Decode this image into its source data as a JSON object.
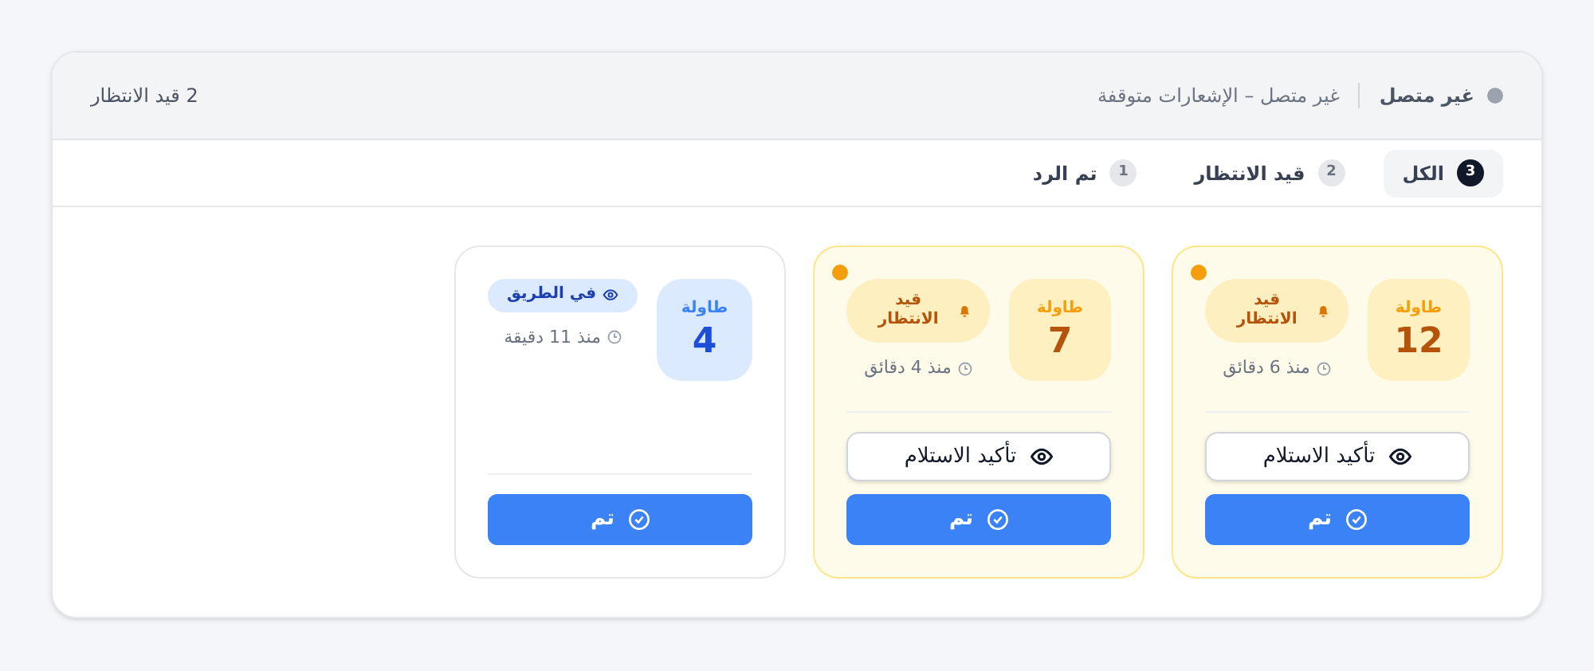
{
  "header": {
    "connection": {
      "label": "غير متصل",
      "color": "#9ca3af"
    },
    "message": "غير متصل – الإشعارات متوقفة",
    "pending_summary": "2 قيد الانتظار"
  },
  "tabs": [
    {
      "label": "الكل",
      "count": "3",
      "selected": true
    },
    {
      "label": "قيد الانتظار",
      "count": "2",
      "selected": false
    },
    {
      "label": "تم الرد",
      "count": "1",
      "selected": false
    }
  ],
  "cards": [
    {
      "kind": "pending",
      "unread": true,
      "table_label": "طاولة",
      "table_number": "12",
      "badge": "قيد الانتظار",
      "time": "منذ 6 دقائق",
      "confirm_button": "تأكيد الاستلام",
      "done_button": "تم"
    },
    {
      "kind": "pending",
      "unread": true,
      "table_label": "طاولة",
      "table_number": "7",
      "badge": "قيد الانتظار",
      "time": "منذ 4 دقائق",
      "confirm_button": "تأكيد الاستلام",
      "done_button": "تم"
    },
    {
      "kind": "on_the_way",
      "unread": false,
      "table_label": "طاولة",
      "table_number": "4",
      "badge": "في الطريق",
      "time": "منذ 11 دقيقة",
      "done_button": "تم"
    }
  ]
}
